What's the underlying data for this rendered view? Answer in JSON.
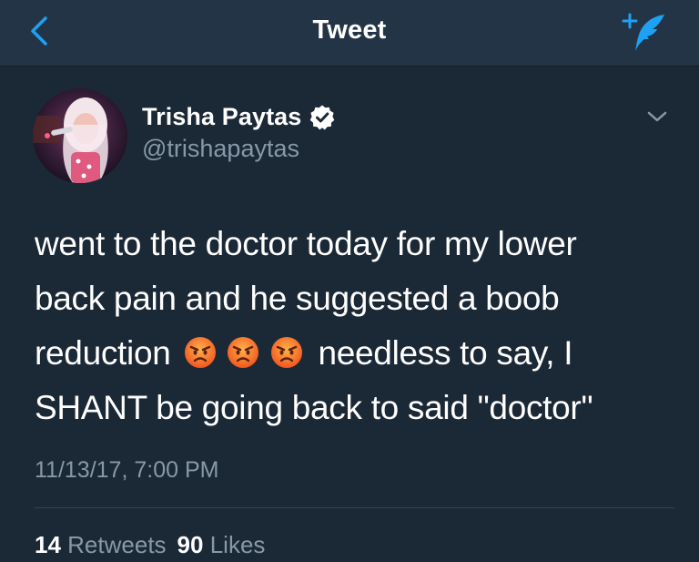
{
  "navbar": {
    "title": "Tweet",
    "back_icon": "chevron-left-icon",
    "compose_icon": "compose-tweet-icon",
    "accent_color": "#1da1f2"
  },
  "author": {
    "name": "Trisha Paytas",
    "handle": "@trishapaytas",
    "verified": true,
    "verified_icon": "verified-badge-icon"
  },
  "tweet": {
    "lines": [
      "went to the doctor today for my lower",
      "back pain and he suggested a boob",
      "reduction",
      "needless to say, I",
      "SHANT be going back to said \"doctor\""
    ],
    "emoji": [
      "angry-face-icon",
      "angry-face-icon",
      "angry-face-icon"
    ],
    "timestamp": "11/13/17, 7:00 PM"
  },
  "stats": {
    "retweets_count": "14",
    "retweets_label": "Retweets",
    "likes_count": "90",
    "likes_label": "Likes"
  },
  "colors": {
    "background": "#1b2836",
    "navbar": "#243447",
    "secondary_text": "#8899a6"
  }
}
